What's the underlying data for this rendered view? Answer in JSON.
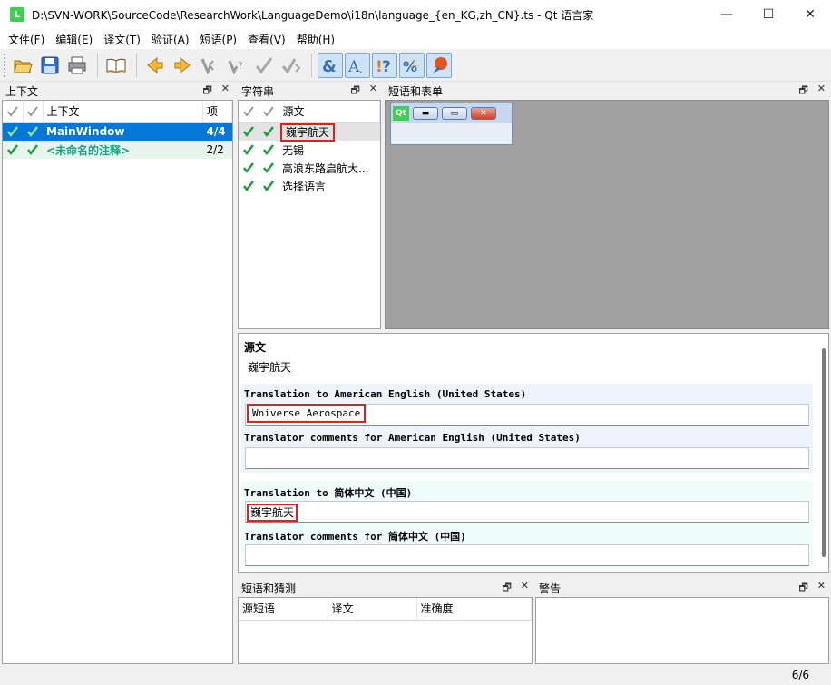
{
  "window": {
    "app_icon_letter": "L",
    "title": "D:\\SVN-WORK\\SourceCode\\ResearchWork\\LanguageDemo\\i18n\\language_{en_KG,zh_CN}.ts - Qt 语言家",
    "minimize": "—",
    "maximize": "☐",
    "close": "✕"
  },
  "menu": [
    "文件(F)",
    "编辑(E)",
    "译文(T)",
    "验证(A)",
    "短语(P)",
    "查看(V)",
    "帮助(H)"
  ],
  "toolbar": {
    "icons": [
      "open-icon",
      "save-icon",
      "print-icon",
      "phrasebook-icon",
      "prev-icon",
      "next-icon",
      "prev-unfinished-icon",
      "next-unfinished-icon",
      "done-icon",
      "done-next-icon",
      "accelerator-check-icon",
      "punctuation-check-icon",
      "phrase-check-icon",
      "placemarker-check-icon",
      "surrounding-whitespace-icon"
    ]
  },
  "context_pane": {
    "title": "上下文",
    "columns": [
      "上下文",
      "项"
    ],
    "rows": [
      {
        "name": "MainWindow",
        "count": "4/4"
      },
      {
        "name": "<未命名的注释>",
        "count": "2/2"
      }
    ]
  },
  "strings_pane": {
    "title": "字符串",
    "column": "源文",
    "rows": [
      "巍宇航天",
      "无锡",
      "高浪东路启航大...",
      "选择语言"
    ]
  },
  "phrases_pane": {
    "title": "短语和表单",
    "preview_logo": "Qt"
  },
  "editor": {
    "source_label": "源文",
    "source_text": "巍宇航天",
    "translation_en_label": "Translation to American English (United States)",
    "translation_en_value": "Wniverse Aerospace",
    "comments_en_label": "Translator comments for American English (United States)",
    "comments_en_value": "",
    "translation_zh_label": "Translation to 简体中文 (中国)",
    "translation_zh_value": "巍宇航天",
    "comments_zh_label": "Translator comments for 简体中文 (中国)",
    "comments_zh_value": ""
  },
  "guess_pane": {
    "title": "短语和猜测",
    "columns": [
      "源短语",
      "译文",
      "准确度"
    ]
  },
  "warn_pane": {
    "title": "警告"
  },
  "status": {
    "count": "6/6"
  },
  "colors": {
    "selection": "#0078d7",
    "done_check": "#1f9d3a",
    "highlight_box": "#e02020",
    "qt_green": "#41cd52"
  }
}
